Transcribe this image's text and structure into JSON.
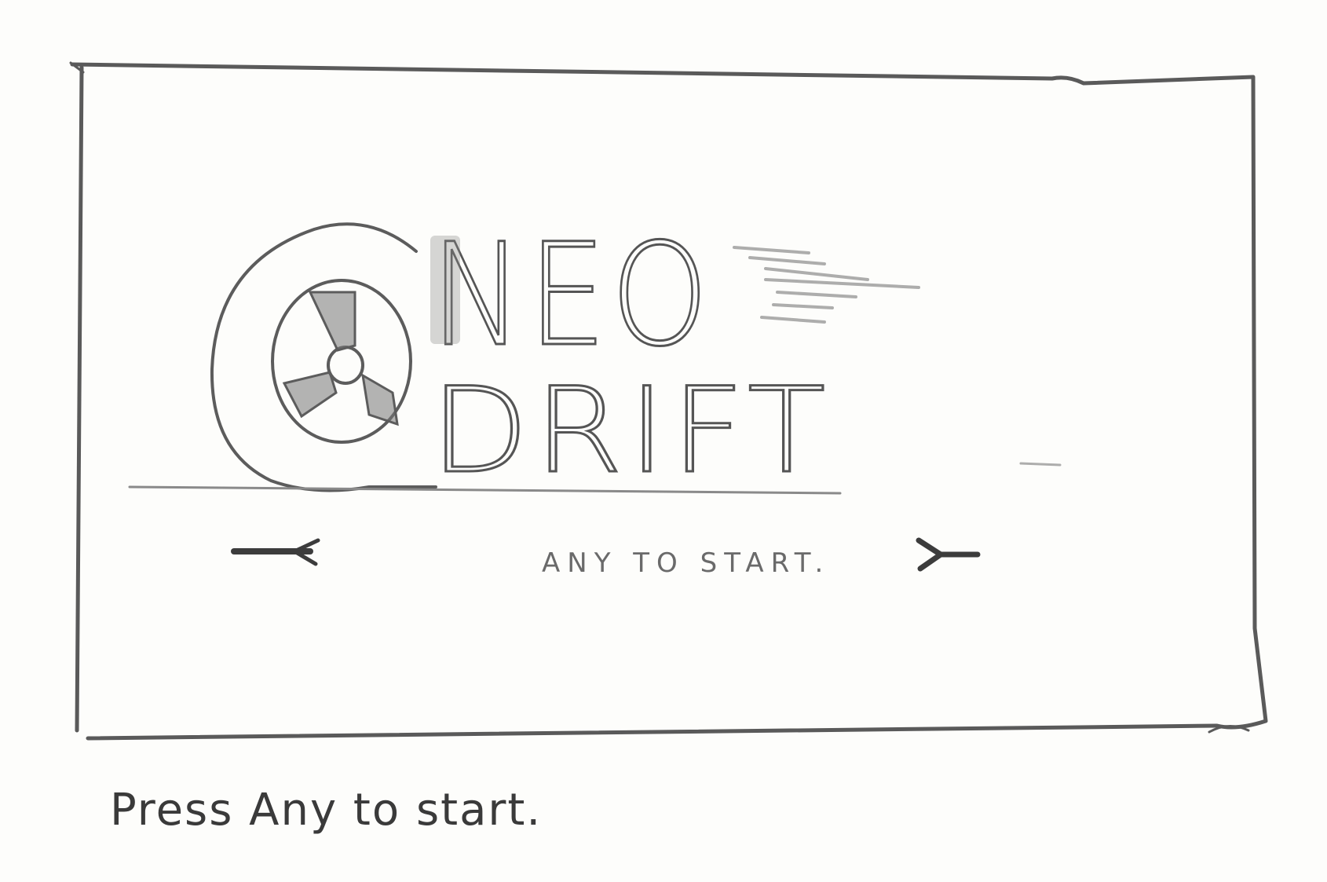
{
  "screen": {
    "title_line1": "NEO",
    "title_line2": "DRIFT",
    "prompt": "ANY TO START.",
    "logo_icon": "wheel-icon"
  },
  "caption": "Press Any to start."
}
